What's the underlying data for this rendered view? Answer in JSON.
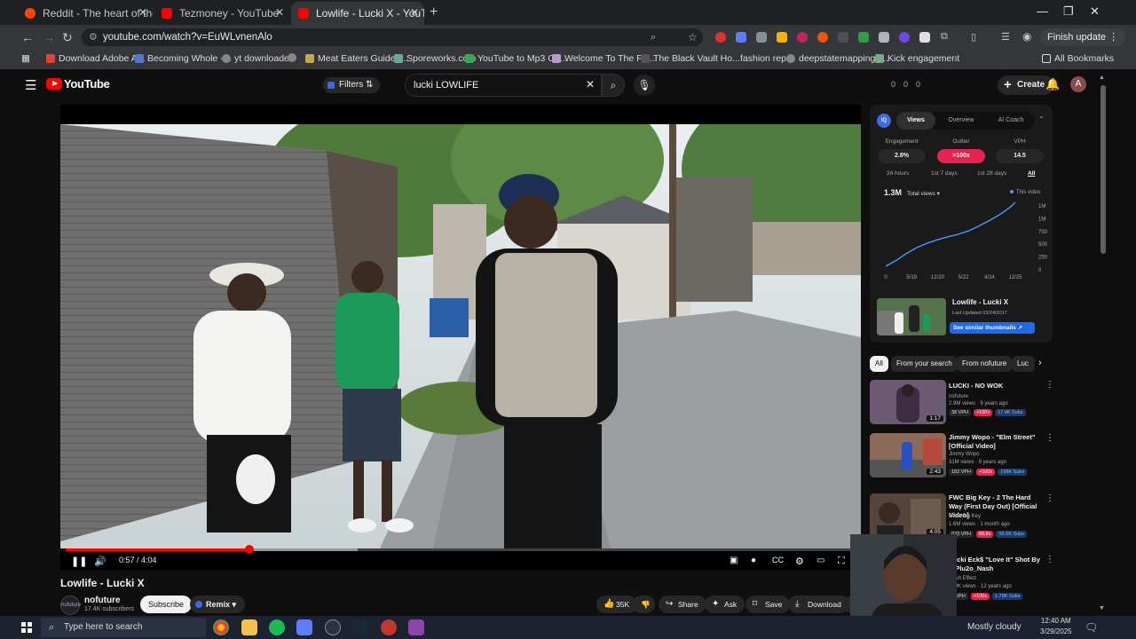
{
  "browser": {
    "tabs": [
      {
        "title": "Reddit - The heart of the interne",
        "color": "#ff4500"
      },
      {
        "title": "Tezmoney - YouTube",
        "color": "#ff0000"
      },
      {
        "title": "Lowlife - Lucki X - YouTube",
        "color": "#ff0000"
      }
    ],
    "url": "youtube.com/watch?v=EuWLvnenAlo",
    "finish_update": "Finish update",
    "bookmarks": [
      {
        "label": "Download Adobe A...",
        "color": "#e34234"
      },
      {
        "label": "Becoming Whole -...",
        "color": "#4a7bd0"
      },
      {
        "label": "yt downloader",
        "color": "#888888"
      },
      {
        "label": "",
        "color": "#888888"
      },
      {
        "label": "Meat Eaters Guide t...",
        "color": "#c8a84a"
      },
      {
        "label": "Sporeworks.com",
        "color": "#6a9"
      },
      {
        "label": "YouTube to Mp3 Co...",
        "color": "#3a5"
      },
      {
        "label": "Welcome To The Fift...",
        "color": "#b9c"
      },
      {
        "label": "The Black Vault Ho...",
        "color": "#555555"
      },
      {
        "label": "fashion reps",
        "color": "#35363a"
      },
      {
        "label": "deepstatemappingp...",
        "color": "#888888"
      },
      {
        "label": "Kick engagement",
        "color": "#7a8"
      }
    ],
    "all_bookmarks": "All Bookmarks"
  },
  "youtube": {
    "logo_text": "YouTube",
    "filters_label": "Filters",
    "search_value": "lucki LOWLIFE",
    "top_counts": [
      "0",
      "0",
      "0"
    ],
    "create_label": "Create",
    "avatar_letter": "A"
  },
  "player": {
    "time": "0:57 / 4:04",
    "progress": 0.233,
    "buffered": 0.37
  },
  "video": {
    "title": "Lowlife - Lucki X",
    "channel": "nofuture",
    "channel_avatar_text": "nofuture",
    "subscribers": "17.4K subscribers",
    "subscribe_label": "Subscribe",
    "remix_label": "Remix",
    "likes": "35K",
    "share_label": "Share",
    "ask_label": "Ask",
    "save_label": "Save",
    "download_label": "Download"
  },
  "stats_panel": {
    "logo": "IQ",
    "tabs": [
      "Views",
      "Overview",
      "AI Coach"
    ],
    "metrics": [
      {
        "label": "Engagement",
        "value": "2.8%"
      },
      {
        "label": "Outlier",
        "value": ">100x"
      },
      {
        "label": "VPH",
        "value": "14.5"
      }
    ],
    "ranges": [
      "24 hours",
      "1st 7 days",
      "1st 28 days",
      "All"
    ],
    "total_views": "1.3M",
    "total_views_label": "Total views",
    "legend": "This video",
    "video_title": "Lowlife - Lucki X",
    "updated": "Last Updated 03/24/2017",
    "similar_label": "See similar thumbnails"
  },
  "chart_data": {
    "type": "line",
    "title": "",
    "x_ticks": [
      "0",
      "5/19",
      "12/20",
      "5/22",
      "4/24",
      "12/25"
    ],
    "y_ticks": [
      "1M",
      "1M",
      "750K",
      "500K",
      "250K",
      "0"
    ],
    "ylim": [
      0,
      1300000
    ],
    "x": [
      0,
      0.08,
      0.16,
      0.24,
      0.32,
      0.4,
      0.48,
      0.56,
      0.64,
      0.72,
      0.8,
      0.88,
      0.96,
      1.0
    ],
    "series": [
      {
        "name": "This video",
        "values": [
          0,
          120000,
          260000,
          380000,
          470000,
          540000,
          600000,
          650000,
          720000,
          820000,
          930000,
          1050000,
          1200000,
          1300000
        ]
      }
    ]
  },
  "related_chips": [
    "All",
    "From your search",
    "From nofuture",
    "Luc"
  ],
  "recommended": [
    {
      "title": "LUCKI - NO WOK",
      "channel": "nofuture",
      "meta": "2.9M views · 9 years ago",
      "duration": "1:17",
      "vph": "38 VPH",
      "outlier": ">100x",
      "subs": "17.4K Subs",
      "thumb": "#5b4a63"
    },
    {
      "title": "Jimmy Wopo - \"Elm Street\" [Official Video]",
      "channel": "Jimmy Wopo",
      "meta": "31M views · 9 years ago",
      "duration": "2:43",
      "vph": "182 VPH",
      "outlier": ">100x",
      "subs": "168K Subs",
      "thumb": "#7a5a48"
    },
    {
      "title": "FWC Big Key - 2 The Hard Way (First Day Out) [Official Video]",
      "channel": "FWC Big Key",
      "meta": "1.6M views · 1 month ago",
      "duration": "4:05",
      "vph": "633 VPH",
      "outlier": "89.8x",
      "subs": "56.6K Subs",
      "thumb": "#4a3a35"
    },
    {
      "title": "Lucki Eck$ \"Love It\" Shot By @Plu2o_Nash",
      "channel": "Nash Effect",
      "meta": "189K views · 12 years ago",
      "duration": "",
      "vph": "3 VPH",
      "outlier": ">100x",
      "subs": "1.78K Subs",
      "thumb": "#3c3c3c"
    }
  ],
  "taskbar": {
    "search_placeholder": "Type here to search",
    "weather": "Mostly cloudy",
    "time": "12:40 AM",
    "date": "3/29/2025"
  }
}
